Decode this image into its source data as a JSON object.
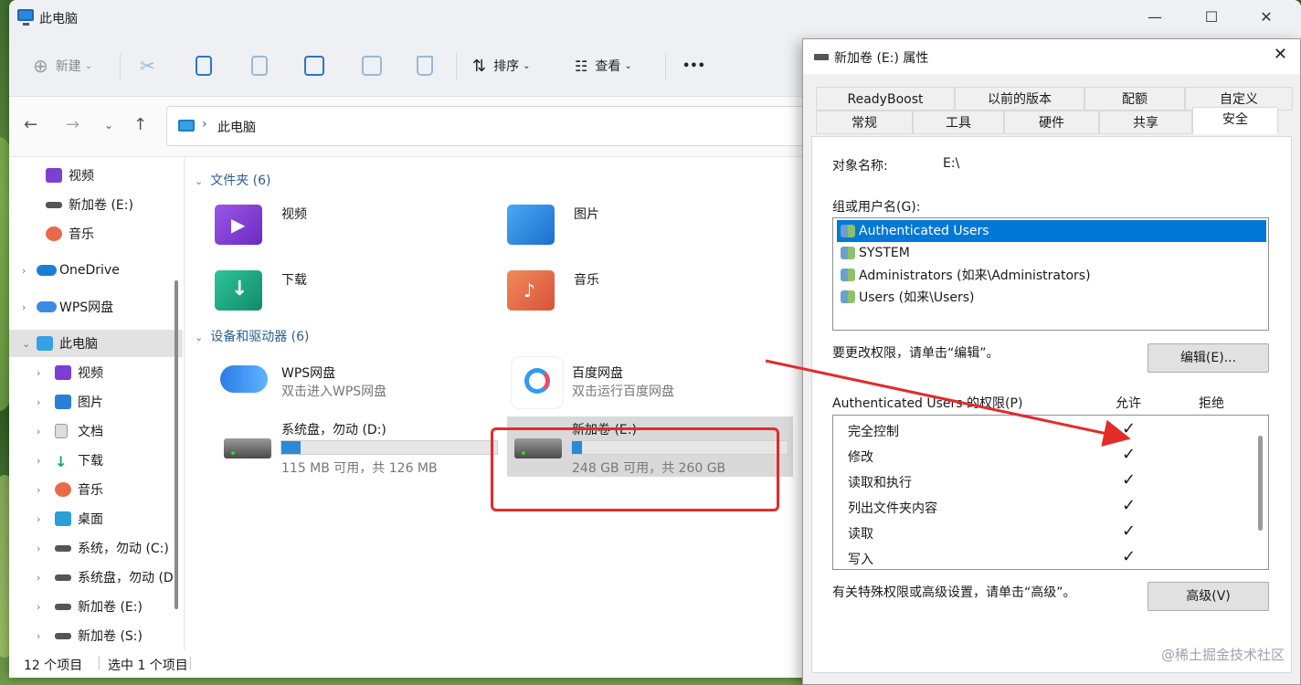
{
  "explorer": {
    "title": "此电脑",
    "window_controls": {
      "minimize": "—",
      "maximize": "☐",
      "close": "✕"
    },
    "toolbar": {
      "new_label": "新建",
      "sort_label": "排序",
      "view_label": "查看",
      "more_label": "•••"
    },
    "breadcrumb": "此电脑",
    "sidebar": [
      {
        "label": "视频",
        "icon": "video-icon"
      },
      {
        "label": "新加卷 (E:)",
        "icon": "drive-icon"
      },
      {
        "label": "音乐",
        "icon": "music-icon"
      },
      {
        "label": "OneDrive",
        "icon": "cloud-icon"
      },
      {
        "label": "WPS网盘",
        "icon": "cloud-icon"
      },
      {
        "label": "此电脑",
        "icon": "pc-icon"
      },
      {
        "label": "视频",
        "icon": "video-icon"
      },
      {
        "label": "图片",
        "icon": "picture-icon"
      },
      {
        "label": "文档",
        "icon": "document-icon"
      },
      {
        "label": "下载",
        "icon": "download-icon"
      },
      {
        "label": "音乐",
        "icon": "music-icon"
      },
      {
        "label": "桌面",
        "icon": "desktop-icon"
      },
      {
        "label": "系统，勿动 (C:)",
        "icon": "drive-icon"
      },
      {
        "label": "系统盘，勿动 (D",
        "icon": "drive-icon"
      },
      {
        "label": "新加卷 (E:)",
        "icon": "drive-icon"
      },
      {
        "label": "新加卷 (S:)",
        "icon": "drive-icon"
      }
    ],
    "folders_header": "文件夹 (6)",
    "folders": [
      {
        "name": "视频"
      },
      {
        "name": "图片"
      },
      {
        "name": "下载"
      },
      {
        "name": "音乐"
      }
    ],
    "devices_header": "设备和驱动器 (6)",
    "devices": [
      {
        "name": "WPS网盘",
        "sub": "双击进入WPS网盘"
      },
      {
        "name": "百度网盘",
        "sub": "双击运行百度网盘"
      },
      {
        "name": "系统盘，勿动 (D:)",
        "sub": "115 MB 可用，共 126 MB",
        "usage": 0.087
      },
      {
        "name": "新加卷 (E:)",
        "sub": "248 GB 可用，共 260 GB",
        "usage": 0.046
      }
    ],
    "status": {
      "count": "12 个项目",
      "selected": "选中 1 个项目"
    }
  },
  "dialog": {
    "title": "新加卷 (E:) 属性",
    "close": "✕",
    "tabs_row1": [
      "ReadyBoost",
      "以前的版本",
      "配额",
      "自定义"
    ],
    "tabs_row2": [
      "常规",
      "工具",
      "硬件",
      "共享",
      "安全"
    ],
    "object_label": "对象名称:",
    "object_value": "E:\\",
    "group_label": "组或用户名(G):",
    "users": [
      "Authenticated Users",
      "SYSTEM",
      "Administrators (如来\\Administrators)",
      "Users (如来\\Users)"
    ],
    "change_hint": "要更改权限，请单击“编辑”。",
    "edit_button": "编辑(E)...",
    "perm_header": "Authenticated Users 的权限(P)",
    "allow_col": "允许",
    "deny_col": "拒绝",
    "permissions": [
      {
        "name": "完全控制",
        "allow": "✓"
      },
      {
        "name": "修改",
        "allow": "✓"
      },
      {
        "name": "读取和执行",
        "allow": "✓"
      },
      {
        "name": "列出文件夹内容",
        "allow": "✓"
      },
      {
        "name": "读取",
        "allow": "✓"
      },
      {
        "name": "写入",
        "allow": "✓"
      }
    ],
    "advanced_hint": "有关特殊权限或高级设置，请单击“高级”。",
    "advanced_button": "高级(V)"
  },
  "watermark": "@稀土掘金技术社区",
  "colors": {
    "accent": "#0078d7",
    "annotation": "#e52a2a"
  }
}
